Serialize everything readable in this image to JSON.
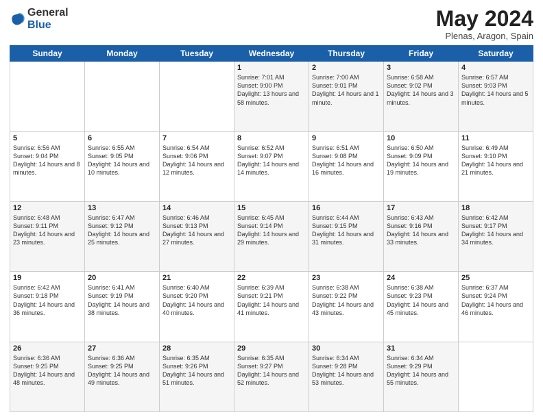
{
  "header": {
    "logo_general": "General",
    "logo_blue": "Blue",
    "month": "May 2024",
    "location": "Plenas, Aragon, Spain"
  },
  "days_of_week": [
    "Sunday",
    "Monday",
    "Tuesday",
    "Wednesday",
    "Thursday",
    "Friday",
    "Saturday"
  ],
  "weeks": [
    [
      {
        "day": "",
        "info": ""
      },
      {
        "day": "",
        "info": ""
      },
      {
        "day": "",
        "info": ""
      },
      {
        "day": "1",
        "info": "Sunrise: 7:01 AM\nSunset: 9:00 PM\nDaylight: 13 hours\nand 58 minutes."
      },
      {
        "day": "2",
        "info": "Sunrise: 7:00 AM\nSunset: 9:01 PM\nDaylight: 14 hours\nand 1 minute."
      },
      {
        "day": "3",
        "info": "Sunrise: 6:58 AM\nSunset: 9:02 PM\nDaylight: 14 hours\nand 3 minutes."
      },
      {
        "day": "4",
        "info": "Sunrise: 6:57 AM\nSunset: 9:03 PM\nDaylight: 14 hours\nand 5 minutes."
      }
    ],
    [
      {
        "day": "5",
        "info": "Sunrise: 6:56 AM\nSunset: 9:04 PM\nDaylight: 14 hours\nand 8 minutes."
      },
      {
        "day": "6",
        "info": "Sunrise: 6:55 AM\nSunset: 9:05 PM\nDaylight: 14 hours\nand 10 minutes."
      },
      {
        "day": "7",
        "info": "Sunrise: 6:54 AM\nSunset: 9:06 PM\nDaylight: 14 hours\nand 12 minutes."
      },
      {
        "day": "8",
        "info": "Sunrise: 6:52 AM\nSunset: 9:07 PM\nDaylight: 14 hours\nand 14 minutes."
      },
      {
        "day": "9",
        "info": "Sunrise: 6:51 AM\nSunset: 9:08 PM\nDaylight: 14 hours\nand 16 minutes."
      },
      {
        "day": "10",
        "info": "Sunrise: 6:50 AM\nSunset: 9:09 PM\nDaylight: 14 hours\nand 19 minutes."
      },
      {
        "day": "11",
        "info": "Sunrise: 6:49 AM\nSunset: 9:10 PM\nDaylight: 14 hours\nand 21 minutes."
      }
    ],
    [
      {
        "day": "12",
        "info": "Sunrise: 6:48 AM\nSunset: 9:11 PM\nDaylight: 14 hours\nand 23 minutes."
      },
      {
        "day": "13",
        "info": "Sunrise: 6:47 AM\nSunset: 9:12 PM\nDaylight: 14 hours\nand 25 minutes."
      },
      {
        "day": "14",
        "info": "Sunrise: 6:46 AM\nSunset: 9:13 PM\nDaylight: 14 hours\nand 27 minutes."
      },
      {
        "day": "15",
        "info": "Sunrise: 6:45 AM\nSunset: 9:14 PM\nDaylight: 14 hours\nand 29 minutes."
      },
      {
        "day": "16",
        "info": "Sunrise: 6:44 AM\nSunset: 9:15 PM\nDaylight: 14 hours\nand 31 minutes."
      },
      {
        "day": "17",
        "info": "Sunrise: 6:43 AM\nSunset: 9:16 PM\nDaylight: 14 hours\nand 33 minutes."
      },
      {
        "day": "18",
        "info": "Sunrise: 6:42 AM\nSunset: 9:17 PM\nDaylight: 14 hours\nand 34 minutes."
      }
    ],
    [
      {
        "day": "19",
        "info": "Sunrise: 6:42 AM\nSunset: 9:18 PM\nDaylight: 14 hours\nand 36 minutes."
      },
      {
        "day": "20",
        "info": "Sunrise: 6:41 AM\nSunset: 9:19 PM\nDaylight: 14 hours\nand 38 minutes."
      },
      {
        "day": "21",
        "info": "Sunrise: 6:40 AM\nSunset: 9:20 PM\nDaylight: 14 hours\nand 40 minutes."
      },
      {
        "day": "22",
        "info": "Sunrise: 6:39 AM\nSunset: 9:21 PM\nDaylight: 14 hours\nand 41 minutes."
      },
      {
        "day": "23",
        "info": "Sunrise: 6:38 AM\nSunset: 9:22 PM\nDaylight: 14 hours\nand 43 minutes."
      },
      {
        "day": "24",
        "info": "Sunrise: 6:38 AM\nSunset: 9:23 PM\nDaylight: 14 hours\nand 45 minutes."
      },
      {
        "day": "25",
        "info": "Sunrise: 6:37 AM\nSunset: 9:24 PM\nDaylight: 14 hours\nand 46 minutes."
      }
    ],
    [
      {
        "day": "26",
        "info": "Sunrise: 6:36 AM\nSunset: 9:25 PM\nDaylight: 14 hours\nand 48 minutes."
      },
      {
        "day": "27",
        "info": "Sunrise: 6:36 AM\nSunset: 9:25 PM\nDaylight: 14 hours\nand 49 minutes."
      },
      {
        "day": "28",
        "info": "Sunrise: 6:35 AM\nSunset: 9:26 PM\nDaylight: 14 hours\nand 51 minutes."
      },
      {
        "day": "29",
        "info": "Sunrise: 6:35 AM\nSunset: 9:27 PM\nDaylight: 14 hours\nand 52 minutes."
      },
      {
        "day": "30",
        "info": "Sunrise: 6:34 AM\nSunset: 9:28 PM\nDaylight: 14 hours\nand 53 minutes."
      },
      {
        "day": "31",
        "info": "Sunrise: 6:34 AM\nSunset: 9:29 PM\nDaylight: 14 hours\nand 55 minutes."
      },
      {
        "day": "",
        "info": ""
      }
    ]
  ]
}
